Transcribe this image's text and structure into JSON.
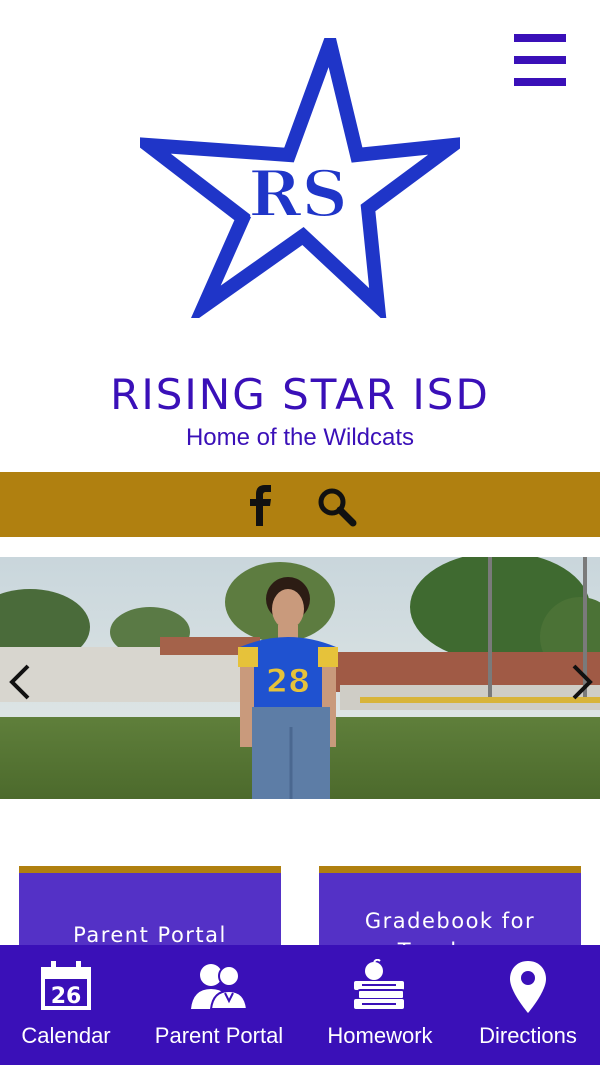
{
  "header": {
    "logo_text": "RS",
    "title": "RISING STAR ISD",
    "subtitle": "Home of the Wildcats",
    "menu_icon": "hamburger-menu-icon"
  },
  "social_bar": {
    "color": "#b08010",
    "icons": [
      "facebook-icon",
      "search-icon"
    ]
  },
  "slider": {
    "jersey_number": "28",
    "prev_icon": "chevron-left-icon",
    "next_icon": "chevron-right-icon"
  },
  "cards": [
    {
      "label": "Parent Portal"
    },
    {
      "label": "Gradebook for",
      "label_line2": "Teachers"
    }
  ],
  "bottom_nav": {
    "items": [
      {
        "label": "Calendar",
        "icon": "calendar-icon",
        "icon_text": "26"
      },
      {
        "label": "Parent Portal",
        "icon": "parents-icon"
      },
      {
        "label": "Homework",
        "icon": "homework-icon"
      },
      {
        "label": "Directions",
        "icon": "map-pin-icon"
      }
    ]
  },
  "colors": {
    "brand_purple": "#3a10b8",
    "card_purple": "#5431c6",
    "gold": "#b08010",
    "logo_blue": "#1f35c8"
  }
}
